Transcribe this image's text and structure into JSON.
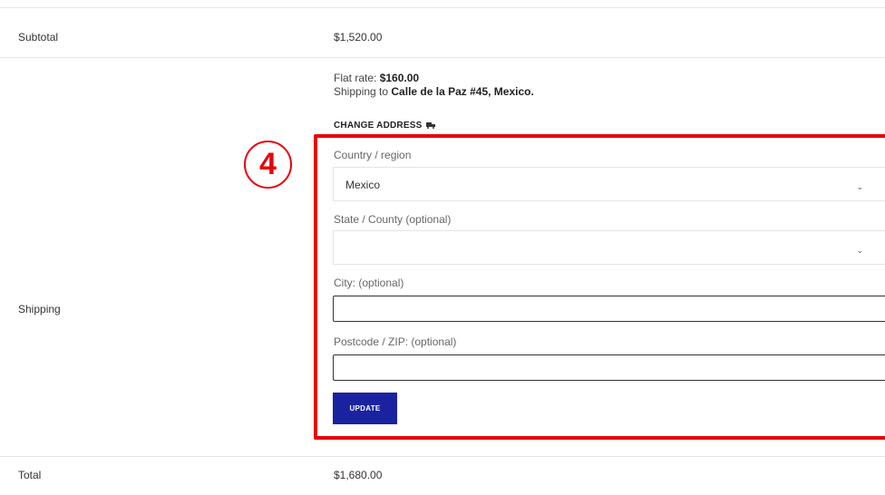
{
  "subtotal": {
    "label": "Subtotal",
    "value": "$1,520.00"
  },
  "shipping": {
    "label": "Shipping",
    "flat_rate_label": "Flat rate:",
    "flat_rate_value": "$160.00",
    "shipping_to_prefix": "Shipping to",
    "shipping_to_address": "Calle de la Paz #45, Mexico.",
    "change_address_label": "CHANGE ADDRESS",
    "form": {
      "country_label": "Country / region",
      "country_value": "Mexico",
      "state_label": "State / County (optional)",
      "state_value": "",
      "city_label": "City: (optional)",
      "city_value": "",
      "postcode_label": "Postcode / ZIP: (optional)",
      "postcode_value": "",
      "update_label": "UPDATE"
    }
  },
  "total": {
    "label": "Total",
    "value": "$1,680.00"
  },
  "annotation": {
    "step_number": "4",
    "color": "#e8000b"
  },
  "colors": {
    "accent": "#1a22a0",
    "highlight": "#e8000b"
  }
}
